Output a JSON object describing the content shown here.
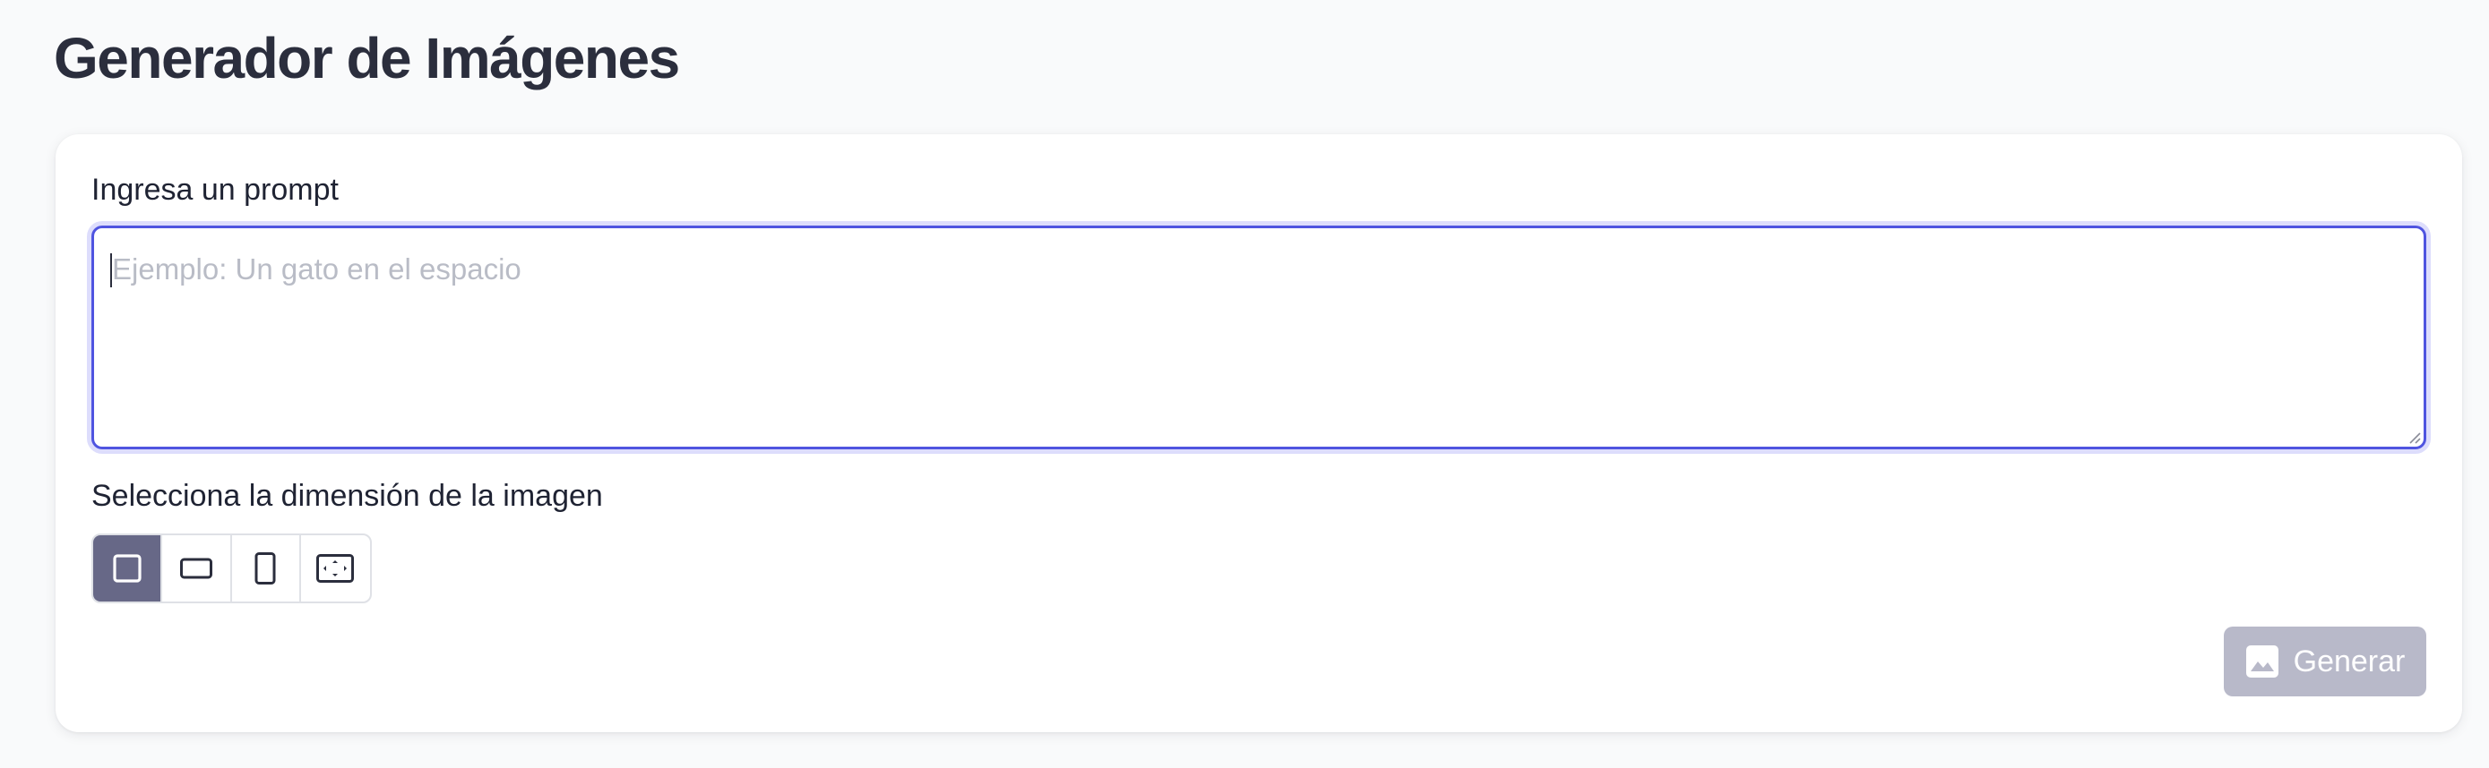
{
  "page": {
    "title": "Generador de Imágenes"
  },
  "prompt": {
    "label": "Ingresa un prompt",
    "value": "",
    "placeholder": "Ejemplo: Un gato en el espacio"
  },
  "dimension": {
    "label": "Selecciona la dimensión de la imagen",
    "options": [
      {
        "icon": "square-icon",
        "selected": true
      },
      {
        "icon": "landscape-icon",
        "selected": false
      },
      {
        "icon": "portrait-icon",
        "selected": false
      },
      {
        "icon": "fullscreen-icon",
        "selected": false
      }
    ]
  },
  "actions": {
    "generate_label": "Generar",
    "generate_icon": "image-icon",
    "generate_enabled": false
  },
  "colors": {
    "accent_focus": "#4f54e0",
    "selected_option": "#676887",
    "disabled_button": "#b8b9c9"
  }
}
